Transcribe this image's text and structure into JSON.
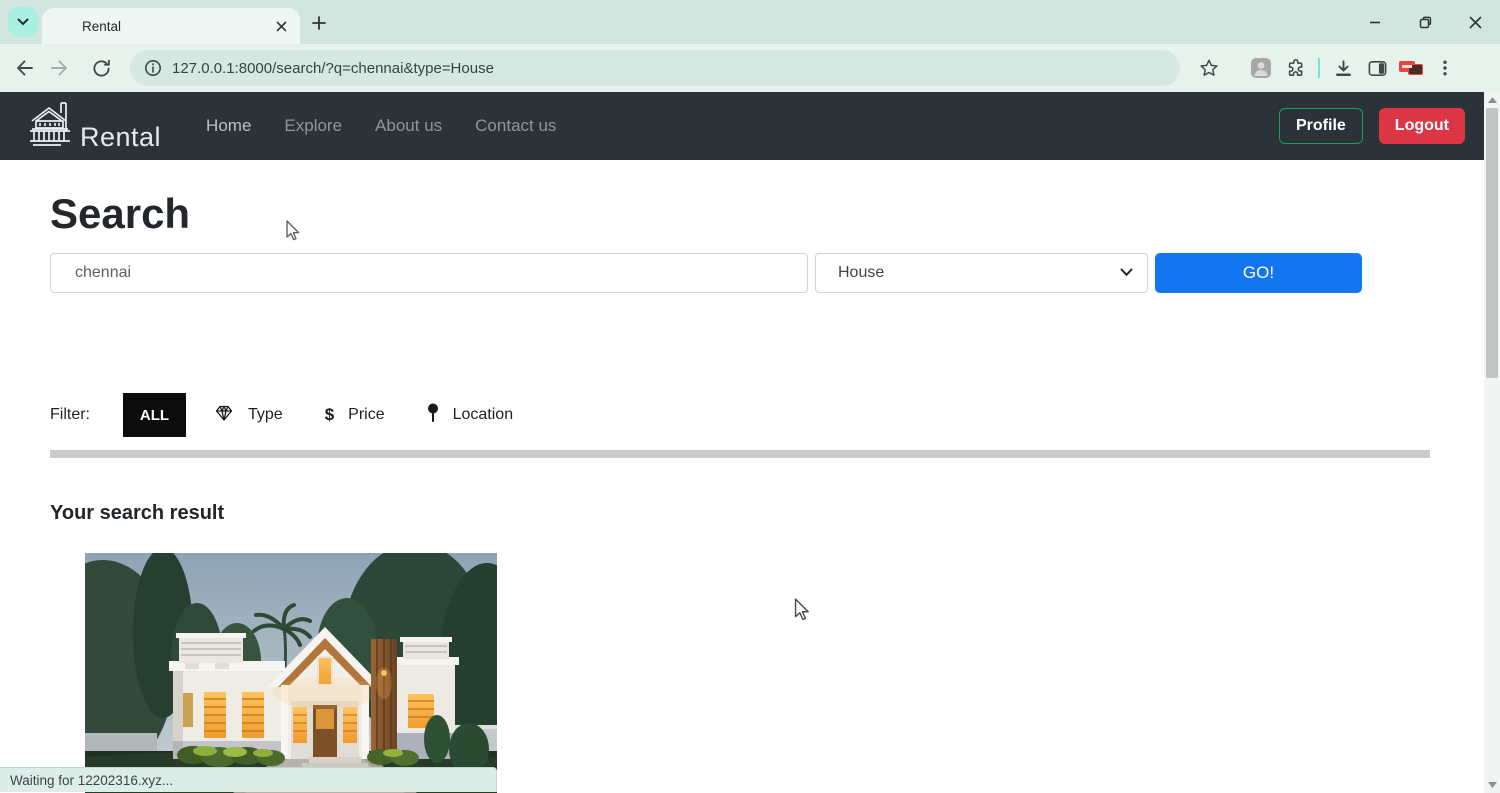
{
  "browser": {
    "tab_title": "Rental",
    "url": "127.0.0.1:8000/search/?q=chennai&type=House",
    "status_text": "Waiting for 12202316.xyz..."
  },
  "navbar": {
    "brand": "Rental",
    "links": [
      "Home",
      "Explore",
      "About us",
      "Contact us"
    ],
    "active_link": "Home",
    "profile_label": "Profile",
    "logout_label": "Logout"
  },
  "search": {
    "heading": "Search",
    "query_value": "chennai",
    "type_selected": "House",
    "go_label": "GO!"
  },
  "filters": {
    "label": "Filter:",
    "all_label": "ALL",
    "type_label": "Type",
    "price_symbol": "$",
    "price_label": "Price",
    "location_label": "Location"
  },
  "results": {
    "heading": "Your search result",
    "listing_image": "house-exterior-dusk-photo"
  },
  "colors": {
    "navbar_bg": "#2b3238",
    "accent_blue": "#1375f0",
    "logout_red": "#dc3545",
    "profile_green": "#1e9e58",
    "chrome_mint": "#d2e5de",
    "filter_active_bg": "#0c0c0c"
  }
}
